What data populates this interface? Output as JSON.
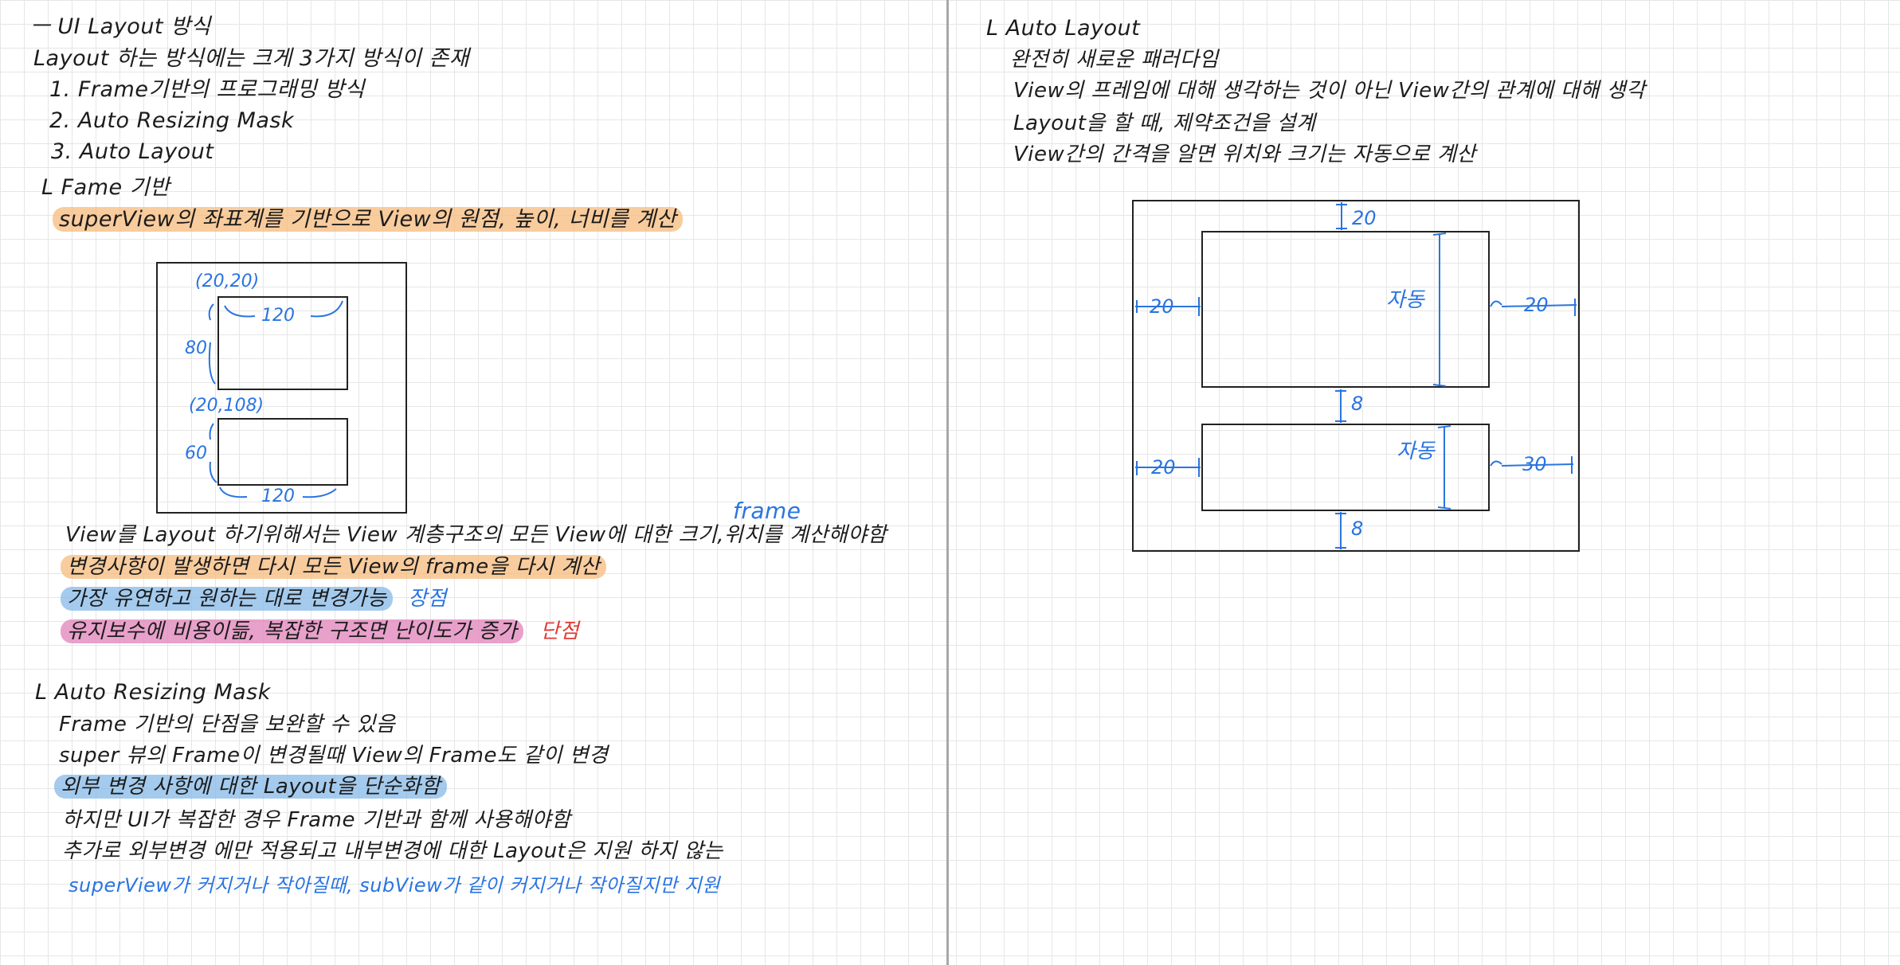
{
  "left": {
    "title": "ㅡ UI Layout 방식",
    "intro": "Layout 하는 방식에는 크게 3가지 방식이 존재",
    "methods": [
      "1. Frame기반의 프로그래밍 방식",
      "2. Auto Resizing Mask",
      "3. Auto Layout"
    ],
    "frame": {
      "heading": "L Fame 기반",
      "desc": "superView의 좌표계를 기반으로 View의 원점, 높이, 너비를 계산",
      "diagram": {
        "origin1": "(20,20)",
        "width1": "120",
        "height1": "80",
        "origin2": "(20,108)",
        "width2": "120",
        "height2": "60",
        "floating_label": "frame"
      },
      "note1": "View를 Layout 하기위해서는 View 계층구조의 모든 View에 대한 크기,위치를 계산해야함",
      "note2": "변경사항이 발생하면 다시 모든 View의 frame을 다시 계산",
      "pro_text": "가장 유연하고 원하는 대로 변경가능",
      "pro_label": "장점",
      "con_text": "유지보수에 비용이듦, 복잡한 구조면 난이도가 증가",
      "con_label": "단점"
    },
    "autoresizing": {
      "heading": "L Auto Resizing Mask",
      "lines": [
        "Frame 기반의 단점을 보완할 수 있음",
        "super 뷰의 Frame이 변경될때 View의 Frame도 같이 변경",
        "외부 변경 사항에 대한 Layout을 단순화함",
        "하지만 UI가 복잡한 경우 Frame 기반과 함께 사용해야함",
        "추가로 외부변경 에만 적용되고 내부변경에 대한 Layout은 지원 하지 않는"
      ],
      "blue_note": "superView가 커지거나 작아질때, subView가 같이 커지거나 작아질지만 지원"
    }
  },
  "right": {
    "heading": "L Auto Layout",
    "lines": [
      "완전히 새로운 패러다임",
      "View의 프레임에 대해 생각하는 것이 아닌 View간의 관계에 대해 생각",
      "Layout을 할 때, 제약조건을 설계",
      "View간의 간격을 알면 위치와 크기는 자동으로 계산"
    ],
    "diagram": {
      "top_gap": "20",
      "left_gap_1": "20",
      "right_gap_1": "20",
      "auto_1": "자동",
      "middle_gap": "8",
      "left_gap_2": "20",
      "right_gap_2": "30",
      "auto_2": "자동",
      "bottom_gap": "8"
    }
  },
  "colors": {
    "highlight_orange": "#f7bb7c",
    "highlight_blue": "#85b9e8",
    "highlight_pink": "#e289be",
    "highlight_green": "#81de70",
    "annotation_blue": "#2a74e0",
    "annotation_red": "#e03b35"
  }
}
